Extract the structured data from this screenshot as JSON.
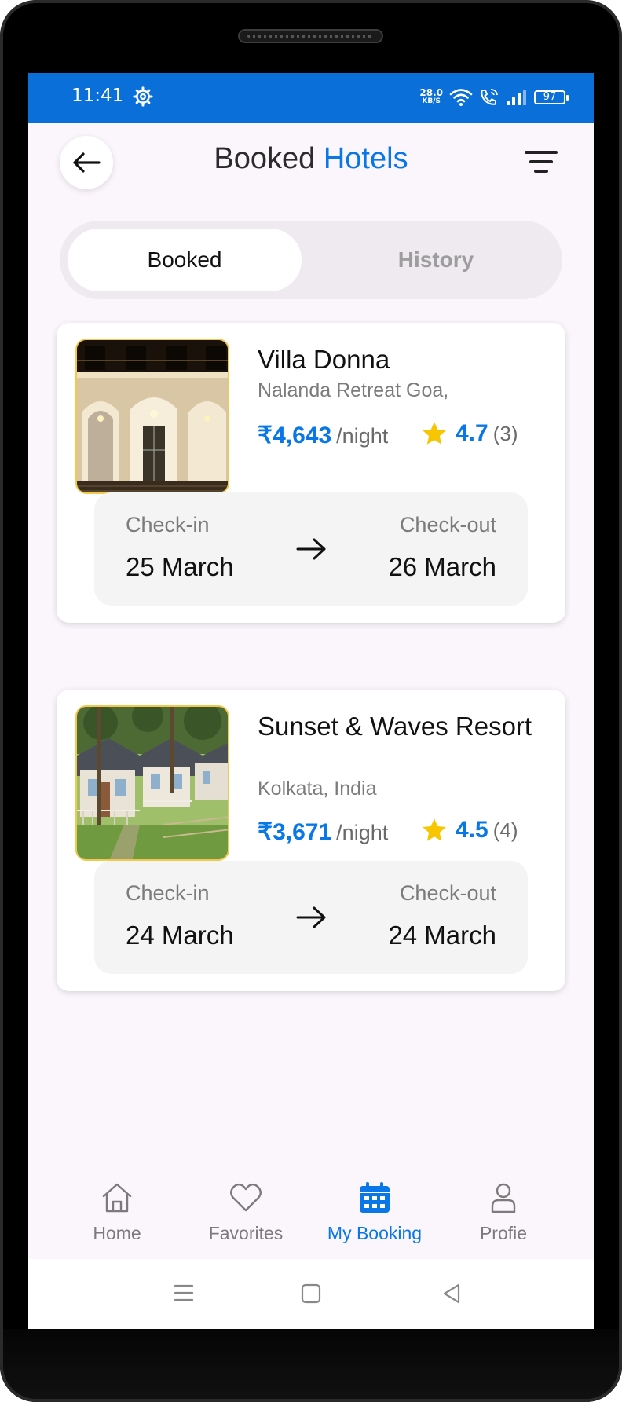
{
  "status_bar": {
    "time": "11:41",
    "net_speed": "28.0",
    "net_unit": "KB/S",
    "battery": "97"
  },
  "header": {
    "title_primary": "Booked",
    "title_accent": "Hotels",
    "accent_color": "#0a77e8"
  },
  "tabs": [
    {
      "label": "Booked",
      "active": true
    },
    {
      "label": "History",
      "active": false
    }
  ],
  "bookings": [
    {
      "name": "Villa Donna",
      "location": "Nalanda Retreat Goa,",
      "price": "₹4,643",
      "per": "/night",
      "rating": "4.7",
      "reviews": "(3)",
      "checkin_label": "Check-in",
      "checkin": "25 March",
      "checkout_label": "Check-out",
      "checkout": "26 March"
    },
    {
      "name": "Sunset & Waves Resort",
      "location": "Kolkata, India",
      "price": "₹3,671",
      "per": "/night",
      "rating": "4.5",
      "reviews": "(4)",
      "checkin_label": "Check-in",
      "checkin": "24 March",
      "checkout_label": "Check-out",
      "checkout": "24 March"
    }
  ],
  "bottom_nav": [
    {
      "label": "Home",
      "icon": "home-icon"
    },
    {
      "label": "Favorites",
      "icon": "heart-icon"
    },
    {
      "label": "My Booking",
      "icon": "calendar-icon",
      "active": true
    },
    {
      "label": "Profie",
      "icon": "user-icon"
    }
  ]
}
